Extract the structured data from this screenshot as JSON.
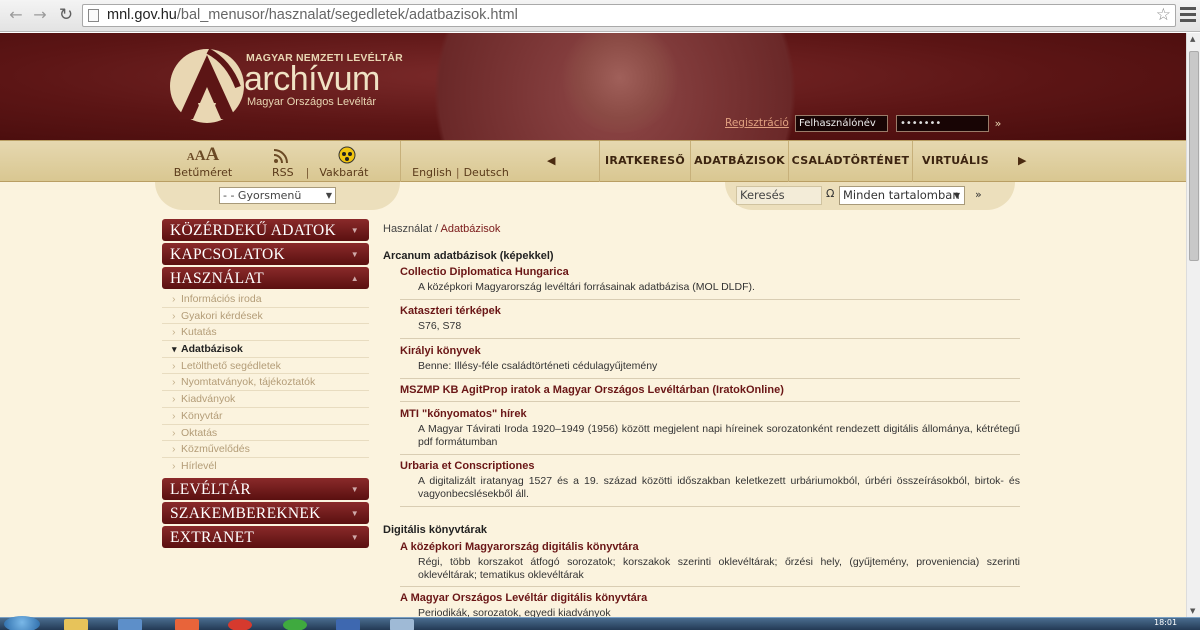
{
  "browser": {
    "url_domain": "mnl.gov.hu",
    "url_path": "/bal_menusor/hasznalat/segedletek/adatbazisok.html"
  },
  "header": {
    "org_line": "MAGYAR NEMZETI LEVÉLTÁR",
    "brand": "archívum",
    "sub_line": "Magyar Országos Levéltár",
    "register": "Regisztráció",
    "username_value": "Felhasználónév",
    "password_value": "•••••••"
  },
  "navbar": {
    "font_glyphs": "AAA",
    "font_label": "Betűméret",
    "rss_label": "RSS",
    "blind_label": "Vakbarát",
    "lang_en": "English",
    "lang_de": "Deutsch",
    "items": [
      "IRATKERESŐ",
      "ADATBÁZISOK",
      "CSALÁDTÖRTÉNET",
      "VIRTUÁLIS"
    ]
  },
  "subbar": {
    "quick_menu": "- - Gyorsmenü",
    "search_value": "Keresés",
    "omega": "Ω",
    "scope": "Minden tartalomban"
  },
  "sidebar": {
    "sections": [
      {
        "label": "KÖZÉRDEKŰ ADATOK"
      },
      {
        "label": "KAPCSOLATOK"
      },
      {
        "label": "HASZNÁLAT"
      },
      {
        "label": "LEVÉLTÁR"
      },
      {
        "label": "SZAKEMBEREKNEK"
      },
      {
        "label": "EXTRANET"
      }
    ],
    "subitems": [
      "Információs iroda",
      "Gyakori kérdések",
      "Kutatás",
      "Adatbázisok",
      "Letölthető segédletek",
      "Nyomtatványok, tájékoztatók",
      "Kiadványok",
      "Könyvtár",
      "Oktatás",
      "Közművelődés",
      "Hírlevél"
    ]
  },
  "content": {
    "breadcrumb_root": "Használat",
    "breadcrumb_sep": " / ",
    "breadcrumb_current": "Adatbázisok",
    "cat1": "Arcanum adatbázisok (képekkel)",
    "cat2": "Digitális könyvtárak",
    "entries": [
      {
        "title": "Collectio Diplomatica Hungarica",
        "desc": "A középkori Magyarország levéltári forrásainak adatbázisa (MOL DLDF)."
      },
      {
        "title": "Kataszteri térképek",
        "desc": "S76, S78"
      },
      {
        "title": "Királyi könyvek",
        "desc": "Benne: Illésy-féle családtörténeti cédulagyűjtemény"
      },
      {
        "title": "MSZMP KB AgitProp iratok a Magyar Országos Levéltárban (IratokOnline)",
        "desc": ""
      },
      {
        "title": "MTI \"kőnyomatos\" hírek",
        "desc": "A Magyar Távirati Iroda 1920–1949 (1956) között megjelent napi híreinek sorozatonként rendezett digitális állománya, kétrétegű pdf formátumban"
      },
      {
        "title": "Urbaria et Conscriptiones",
        "desc": "A digitalizált iratanyag 1527 és a 19. század közötti időszakban keletkezett urbáriumokból, úrbéri összeírásokból, birtok- és vagyonbecslésekből áll."
      },
      {
        "title": "A középkori Magyarország digitális könyvtára",
        "desc": "Régi, több korszakot átfogó sorozatok; korszakok szerinti oklevéltárak; őrzési hely, (gyűjtemény, proveniencia) szerinti oklevéltárak; tematikus oklevéltárak"
      },
      {
        "title": "A Magyar Országos Levéltár digitális könyvtára",
        "desc": "Periodikák, sorozatok, egyedi kiadványok"
      }
    ]
  },
  "taskbar": {
    "clock": "18:01"
  }
}
